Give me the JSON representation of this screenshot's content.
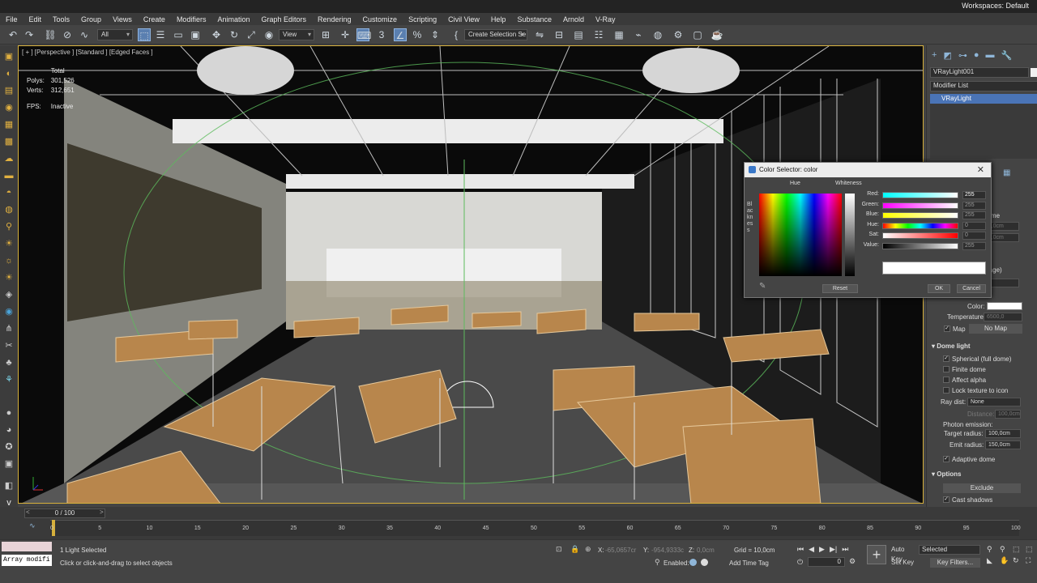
{
  "menu": [
    "File",
    "Edit",
    "Tools",
    "Group",
    "Views",
    "Create",
    "Modifiers",
    "Animation",
    "Graph Editors",
    "Rendering",
    "Customize",
    "Scripting",
    "Civil View",
    "Help",
    "Substance",
    "Arnold",
    "V-Ray"
  ],
  "workspace": {
    "label": "Workspaces:",
    "value": "Default"
  },
  "toolbar": {
    "filter_value": "All",
    "view_value": "View",
    "selection_set_placeholder": "Create Selection Se"
  },
  "viewport": {
    "label": "[ + ] [Perspective ] [Standard ] [Edged Faces ]",
    "stats": {
      "total_label": "Total",
      "polys_label": "Polys:",
      "polys": "301,526",
      "verts_label": "Verts:",
      "verts": "312,651",
      "fps_label": "FPS:",
      "fps": "Inactive"
    }
  },
  "color_dialog": {
    "title": "Color Selector: color",
    "hue_label": "Hue",
    "whiteness_label": "Whiteness",
    "blackness_label": "Blackness",
    "channels": [
      {
        "label": "Red:",
        "value": "255"
      },
      {
        "label": "Green:",
        "value": "255"
      },
      {
        "label": "Blue:",
        "value": "255"
      },
      {
        "label": "Hue:",
        "value": "0"
      },
      {
        "label": "Sat:",
        "value": "0"
      },
      {
        "label": "Value:",
        "value": "255"
      }
    ],
    "reset_label": "Reset",
    "ok_label": "OK",
    "cancel_label": "Cancel"
  },
  "command_panel": {
    "object_name": "VRayLight001",
    "modifier_list_label": "Modifier List",
    "stack_item": "VRayLight",
    "color_label": "Color:",
    "temperature_label": "Temperature:",
    "temperature_value": "6500,0",
    "map_label": "Map",
    "map_button": "No Map",
    "dome_title": "Dome light",
    "spherical_label": "Spherical (full dome)",
    "finite_label": "Finite dome",
    "affect_alpha_label": "Affect alpha",
    "lock_texture_label": "Lock texture to icon",
    "ray_dist_label": "Ray dist:",
    "ray_dist_value": "None",
    "distance_label": "Distance:",
    "distance_value": "100,0cm",
    "photon_label": "Photon emission:",
    "target_radius_label": "Target radius:",
    "target_radius_value": "100,0cm",
    "emit_radius_label": "Emit radius:",
    "emit_radius_value": "150,0cm",
    "adaptive_label": "Adaptive dome",
    "options_title": "Options",
    "exclude_label": "Exclude",
    "cast_shadows_label": "Cast shadows",
    "partial_dome": "dome",
    "partial_1": "100,0cm",
    "partial_2": "100,0cm",
    "partial_image": "mage)",
    "partial_0": "0"
  },
  "timeline": {
    "frame_label": "0 / 100",
    "ticks": [
      "0",
      "5",
      "10",
      "15",
      "20",
      "25",
      "30",
      "35",
      "40",
      "45",
      "50",
      "55",
      "60",
      "65",
      "70",
      "75",
      "80",
      "85",
      "90",
      "95",
      "100"
    ]
  },
  "status": {
    "maxscript_text": "Array modifi",
    "selected_text": "1 Light Selected",
    "prompt_text": "Click or click-and-drag to select objects",
    "x_label": "X:",
    "x_value": "-65,0657cr",
    "y_label": "Y:",
    "y_value": "-954,9333c",
    "z_label": "Z:",
    "z_value": "0,0cm",
    "grid_text": "Grid = 10,0cm",
    "enabled_label": "Enabled:",
    "add_time_tag": "Add Time Tag",
    "auto_key": "Auto Key",
    "set_key": "Set Key",
    "selected_dropdown": "Selected",
    "key_filters": "Key Filters...",
    "frame_value": "0"
  }
}
